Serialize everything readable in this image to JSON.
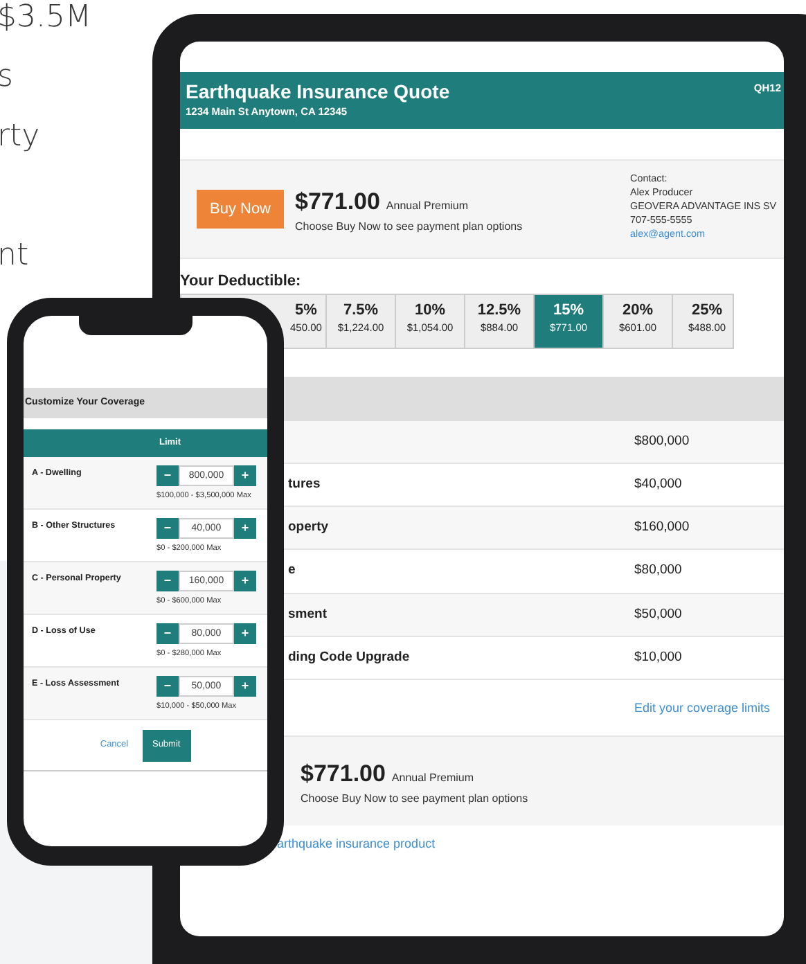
{
  "side_text": [
    "$3.5M",
    "s",
    "rty",
    "nt"
  ],
  "tablet": {
    "header": {
      "title": "Earthquake Insurance Quote",
      "address": "1234 Main St Anytown, CA 12345",
      "quote_id": "QH12"
    },
    "premium": {
      "button": "Buy Now",
      "amount": "$771.00",
      "period": "Annual Premium",
      "note": "Choose Buy Now to see payment plan options"
    },
    "contact": {
      "heading": "Contact:",
      "name": "Alex Producer",
      "agency": "GEOVERA ADVANTAGE INS SV",
      "phone": "707-555-5555",
      "email": "alex@agent.com"
    },
    "deductible": {
      "label": "Your Deductible:",
      "options": [
        {
          "percent": "5%",
          "amount": "450.00",
          "selected": false
        },
        {
          "percent": "7.5%",
          "amount": "$1,224.00",
          "selected": false
        },
        {
          "percent": "10%",
          "amount": "$1,054.00",
          "selected": false
        },
        {
          "percent": "12.5%",
          "amount": "$884.00",
          "selected": false
        },
        {
          "percent": "15%",
          "amount": "$771.00",
          "selected": true
        },
        {
          "percent": "20%",
          "amount": "$601.00",
          "selected": false
        },
        {
          "percent": "25%",
          "amount": "$488.00",
          "selected": false
        }
      ]
    },
    "coverages": [
      {
        "value": "$800,000"
      },
      {
        "label": "tures",
        "value": "$40,000"
      },
      {
        "label": "operty",
        "value": "$160,000"
      },
      {
        "label": "e",
        "value": "$80,000"
      },
      {
        "label": "sment",
        "value": "$50,000"
      },
      {
        "label": "ding Code Upgrade",
        "value": "$10,000"
      }
    ],
    "edit_link": "Edit your coverage limits",
    "footer_premium": {
      "amount": "$771.00",
      "period": "Annual Premium",
      "note": "Choose Buy Now to see payment plan options"
    },
    "product_link": "arthquake insurance product"
  },
  "phone": {
    "title": "Customize Your Coverage",
    "column": "Limit",
    "rows": [
      {
        "label": "A - Dwelling",
        "minus": "−",
        "value": "800,000",
        "plus": "+",
        "range": "$100,000 - $3,500,000 Max"
      },
      {
        "label": "B - Other Structures",
        "minus": "−",
        "value": "40,000",
        "plus": "+",
        "range": "$0 - $200,000 Max"
      },
      {
        "label": "C - Personal Property",
        "minus": "−",
        "value": "160,000",
        "plus": "+",
        "range": "$0 - $600,000 Max"
      },
      {
        "label": "D - Loss of Use",
        "minus": "−",
        "value": "80,000",
        "plus": "+",
        "range": "$0 - $280,000 Max"
      },
      {
        "label": "E - Loss Assessment",
        "minus": "−",
        "value": "50,000",
        "plus": "+",
        "range": "$10,000 - $50,000 Max"
      }
    ],
    "cancel": "Cancel",
    "submit": "Submit"
  }
}
